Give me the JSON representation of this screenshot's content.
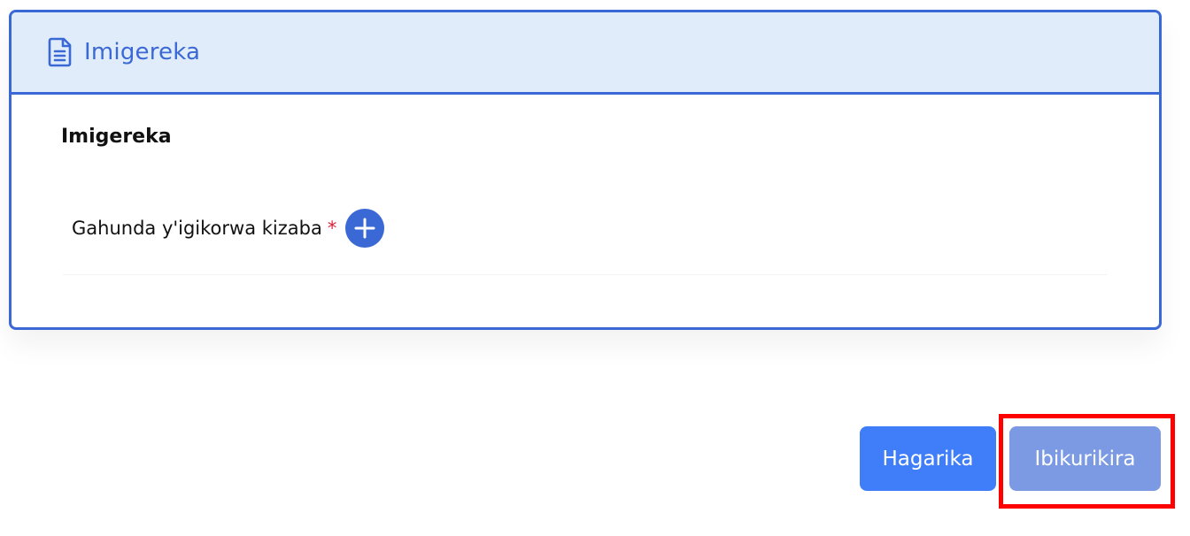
{
  "card": {
    "header_title": "Imigereka",
    "header_icon": "document-icon",
    "section_title": "Imigereka",
    "field_label": "Gahunda y'igikorwa kizaba",
    "required_marker": "*",
    "add_icon": "plus-icon"
  },
  "actions": {
    "cancel_label": "Hagarika",
    "next_label": "Ibikurikira"
  },
  "colors": {
    "accent": "#3a69d6",
    "header_bg": "#e0ecfa",
    "cancel_button": "#3f7ef8",
    "next_button": "#7b9ae3",
    "required": "#d8213a",
    "highlight": "#ff0000"
  }
}
